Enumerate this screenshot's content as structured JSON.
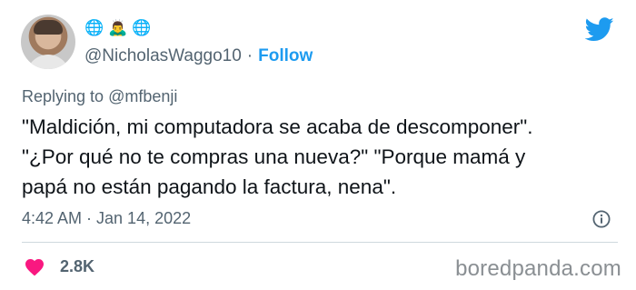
{
  "author": {
    "handle": "@NicholasWaggo10",
    "separator": "·",
    "follow_label": "Follow",
    "name_emojis": [
      "🌐",
      "🙇‍♂️",
      "🌐"
    ]
  },
  "reply": {
    "prefix": "Replying to",
    "mention": "@mfbenji"
  },
  "tweet": {
    "text": "\"Maldición, mi computadora se acaba de descomponer\".\n\"¿Por qué no te compras una nueva?\" \"Porque mamá y\npapá no están pagando la factura, nena\".",
    "meta": "4:42 AM · Jan 14, 2022"
  },
  "engagement": {
    "likes": "2.8K"
  },
  "watermark": "boredpanda.com",
  "colors": {
    "accent": "#1d9bf0",
    "heart": "#f91880",
    "secondary_text": "#536471"
  },
  "icons": {
    "platform": "twitter-bird-icon",
    "info": "info-icon",
    "like": "heart-icon"
  }
}
